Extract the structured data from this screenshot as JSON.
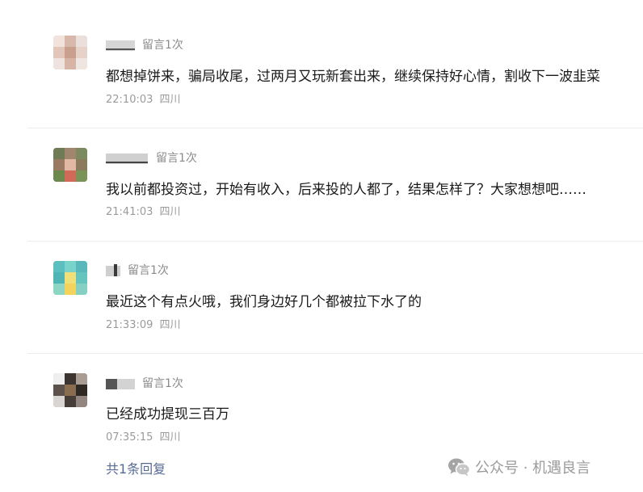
{
  "colors": {
    "link": "#576b95",
    "text": "#1a1a1a",
    "meta": "#9a9a9a",
    "badge": "#8a8a8a",
    "divider": "#ececec"
  },
  "comments": [
    {
      "nickname": "",
      "badge": "留言1次",
      "text": "都想掉饼来，骗局收尾，过两月又玩新套出来，继续保持好心情，割收下一波韭菜",
      "time": "22:10:03",
      "location": "四川",
      "avatar_icon": "pixelated-avatar-icon"
    },
    {
      "nickname": "",
      "badge": "留言1次",
      "text": "我以前都投资过，开始有收入，后来投的人都了，结果怎样了？大家想想吧……",
      "time": "21:41:03",
      "location": "四川",
      "avatar_icon": "pixelated-avatar-icon"
    },
    {
      "nickname": "",
      "badge": "留言1次",
      "text": "最近这个有点火哦，我们身边好几个都被拉下水了的",
      "time": "21:33:09",
      "location": "四川",
      "avatar_icon": "pixelated-avatar-icon"
    },
    {
      "nickname": "",
      "badge": "留言1次",
      "text": "已经成功提现三百万",
      "time": "07:35:15",
      "location": "四川",
      "avatar_icon": "pixelated-avatar-icon"
    }
  ],
  "replies_link": "共1条回复",
  "watermark": {
    "icon": "wechat-icon",
    "text": "公众号 · 机遇良言"
  }
}
